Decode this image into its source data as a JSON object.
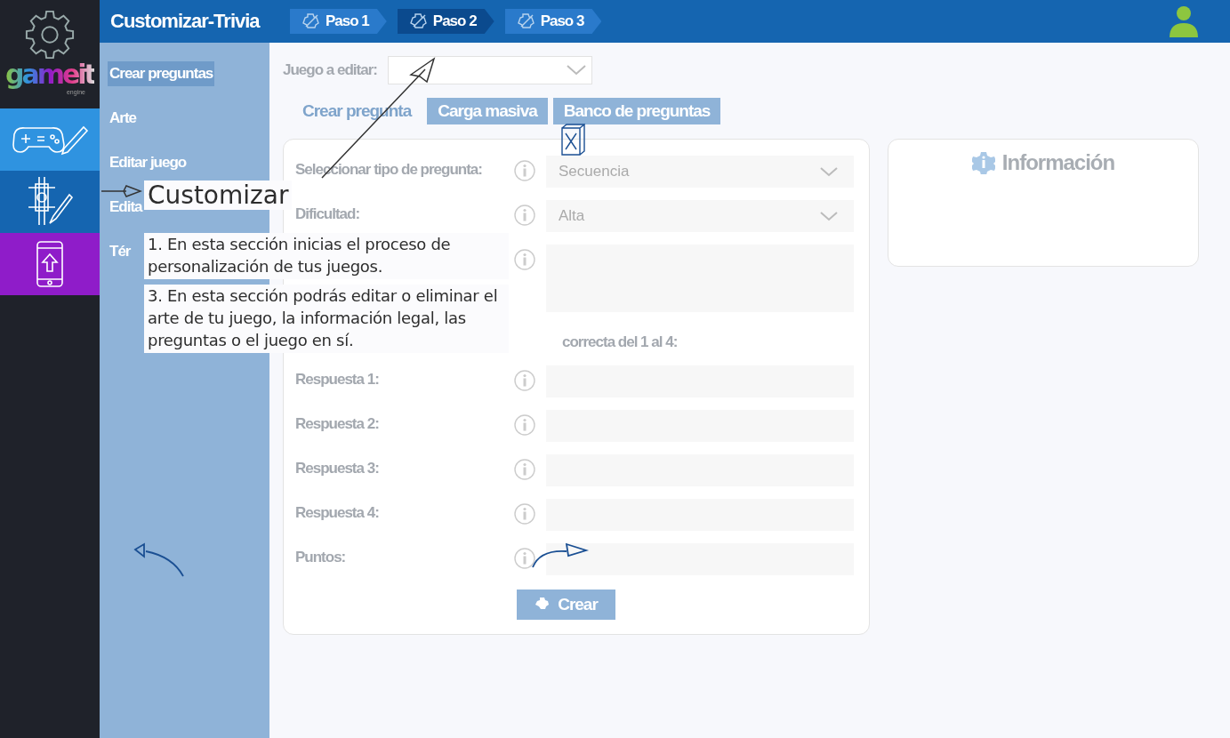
{
  "logo": {
    "text": "gameit",
    "subtext": "engine"
  },
  "rail": [
    {
      "kind": "controller",
      "color": "#2f93e0"
    },
    {
      "kind": "design",
      "color": "#1565b0"
    },
    {
      "kind": "phone",
      "color": "#8f1cc9"
    }
  ],
  "header": {
    "title": "Customizar-Trivia",
    "steps": [
      {
        "label": "Paso 1",
        "selected": false
      },
      {
        "label": "Paso 2",
        "selected": true
      },
      {
        "label": "Paso 3",
        "selected": false
      }
    ]
  },
  "sidebar": {
    "items": [
      {
        "label": "Crear preguntas",
        "selected": true
      },
      {
        "label": "Arte",
        "selected": false
      },
      {
        "label": "Editar juego",
        "selected": false
      },
      {
        "label": "Edita",
        "selected": false
      },
      {
        "label": "Tér",
        "selected": false
      }
    ]
  },
  "editor": {
    "game_label": "Juego a editar:",
    "tabs": [
      {
        "label": "Crear pregunta",
        "selected": true
      },
      {
        "label": "Carga masiva",
        "selected": false
      },
      {
        "label": "Banco de preguntas",
        "selected": false
      }
    ],
    "rows": [
      {
        "kind": "select",
        "label": "Seleccionar tipo de pregunta:",
        "value": "Secuencia"
      },
      {
        "kind": "select",
        "label": "Dificultad:",
        "value": "Alta"
      },
      {
        "kind": "textarea"
      },
      {
        "kind": "note",
        "label": "correcta del  1 al 4:"
      },
      {
        "kind": "input",
        "label": "Respuesta 1:"
      },
      {
        "kind": "input",
        "label": "Respuesta 2:"
      },
      {
        "kind": "input",
        "label": "Respuesta 3:"
      },
      {
        "kind": "input",
        "label": "Respuesta 4:"
      },
      {
        "kind": "input",
        "label": "Puntos:"
      }
    ],
    "button": "Crear"
  },
  "info_panel": {
    "title": "Información"
  },
  "tutorial": {
    "title": "Customizar",
    "notes": [
      "1. En esta sección inicias el proceso de personalización de tus juegos.",
      "3. En esta sección podrás editar o eliminar el arte de tu juego, la información legal, las preguntas o el juego en sí."
    ]
  }
}
